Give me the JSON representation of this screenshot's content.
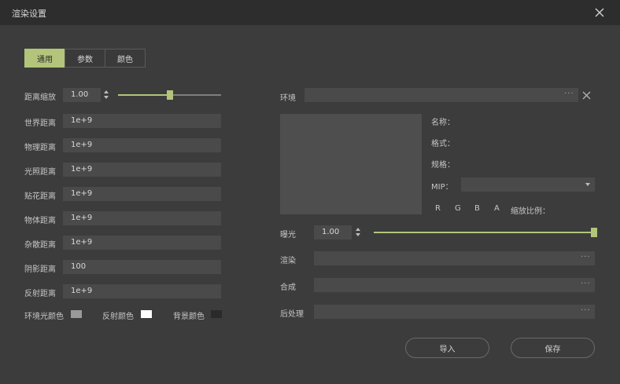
{
  "window": {
    "title": "渲染设置"
  },
  "tabs": [
    "通用",
    "参数",
    "颜色"
  ],
  "left": {
    "scale_label": "距离缩放",
    "scale_value": "1.00",
    "scale_slider_fraction": 0.5,
    "rows": [
      {
        "label": "世界距离",
        "value": "1e+9"
      },
      {
        "label": "物理距离",
        "value": "1e+9"
      },
      {
        "label": "光照距离",
        "value": "1e+9"
      },
      {
        "label": "贴花距离",
        "value": "1e+9"
      },
      {
        "label": "物体距离",
        "value": "1e+9"
      },
      {
        "label": "杂散距离",
        "value": "1e+9"
      },
      {
        "label": "阴影距离",
        "value": "100"
      },
      {
        "label": "反射距离",
        "value": "1e+9"
      }
    ],
    "colors": [
      {
        "label": "环境光颜色",
        "color": "#9a9a9a"
      },
      {
        "label": "反射颜色",
        "color": "#ffffff"
      },
      {
        "label": "背景颜色",
        "color": "#2a2a2a"
      }
    ]
  },
  "right": {
    "env_label": "环境",
    "env_value": "",
    "dots": "···",
    "info": {
      "name": "名称：",
      "format": "格式：",
      "spec": "规格：",
      "mip": "MIP："
    },
    "channels": [
      "R",
      "G",
      "B",
      "A"
    ],
    "scale_ratio": "缩放比例：",
    "exposure_label": "曝光",
    "exposure_value": "1.00",
    "exposure_slider_fraction": 1.0,
    "rows": [
      {
        "label": "渲染",
        "value": ""
      },
      {
        "label": "合成",
        "value": ""
      },
      {
        "label": "后处理",
        "value": ""
      }
    ]
  },
  "buttons": {
    "import": "导入",
    "save": "保存"
  },
  "colors": {
    "accent": "#b2c57a",
    "bg": "#3c3c3c",
    "titlebar": "#2d2d2d",
    "field": "#4a4a4a"
  }
}
